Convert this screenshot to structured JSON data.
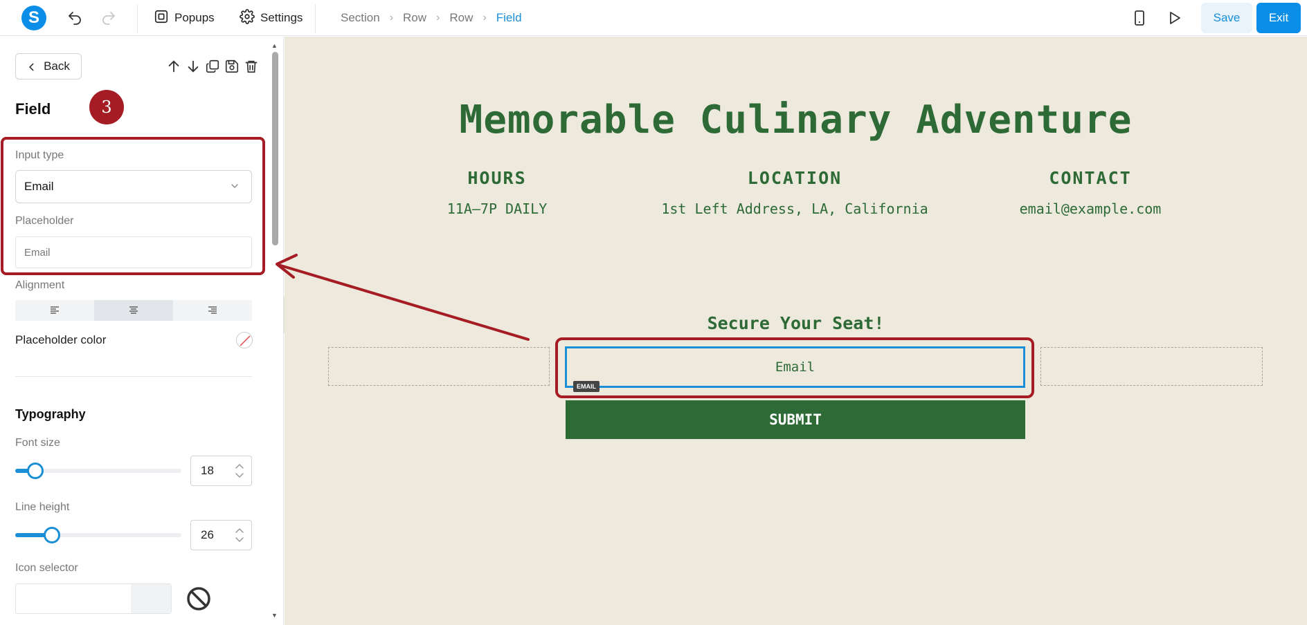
{
  "topbar": {
    "logo_letter": "S",
    "popups_label": "Popups",
    "settings_label": "Settings",
    "breadcrumb": [
      "Section",
      "Row",
      "Row",
      "Field"
    ],
    "save_label": "Save",
    "exit_label": "Exit"
  },
  "sidebar": {
    "back_label": "Back",
    "panel_title": "Field",
    "step_number": "3",
    "input_type_label": "Input type",
    "input_type_value": "Email",
    "placeholder_label": "Placeholder",
    "placeholder_value": "Email",
    "alignment_label": "Alignment",
    "alignment_selected": "center",
    "placeholder_color_label": "Placeholder color",
    "typography_title": "Typography",
    "font_size_label": "Font size",
    "font_size_value": "18",
    "font_size_slider_fraction": 0.12,
    "line_height_label": "Line height",
    "line_height_value": "26",
    "line_height_slider_fraction": 0.22,
    "icon_selector_label": "Icon selector"
  },
  "canvas": {
    "title": "Memorable Culinary Adventure",
    "info": [
      {
        "heading": "HOURS",
        "value": "11A–7P DAILY"
      },
      {
        "heading": "LOCATION",
        "value": "1st Left Address, LA, California"
      },
      {
        "heading": "CONTACT",
        "value": "email@example.com"
      }
    ],
    "form_title": "Secure Your Seat!",
    "email_placeholder": "Email",
    "email_tag": "EMAIL",
    "submit_label": "SUBMIT"
  },
  "colors": {
    "brand_blue": "#0a8ee8",
    "annotation_red": "#a51c24",
    "canvas_bg": "#ede9dd",
    "theme_green": "#2d6a36"
  }
}
